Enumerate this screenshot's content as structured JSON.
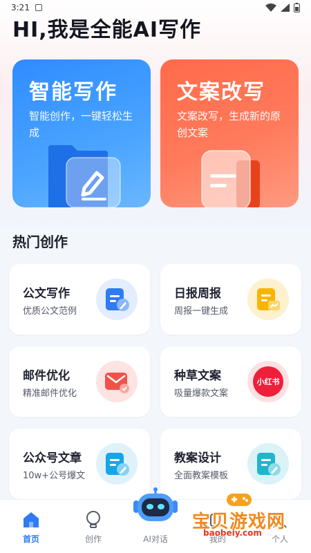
{
  "status": {
    "time": "3:21"
  },
  "header": {
    "title": "HI,我是全能AI写作"
  },
  "features": [
    {
      "title": "智能写作",
      "desc": "智能创作，一键轻松生成",
      "color": "#3a96ff"
    },
    {
      "title": "文案改写",
      "desc": "文案改写，生成新的原创文案",
      "color": "#ff6f50"
    }
  ],
  "section": {
    "title": "热门创作"
  },
  "tiles": [
    {
      "title": "公文写作",
      "sub": "优质公文范例",
      "icon": "document-pen-icon"
    },
    {
      "title": "日报周报",
      "sub": "周报一键生成",
      "icon": "report-chart-icon"
    },
    {
      "title": "邮件优化",
      "sub": "精准邮件优化",
      "icon": "mail-icon"
    },
    {
      "title": "种草文案",
      "sub": "吸量爆款文案",
      "icon": "xiaohongshu-logo",
      "logo_text": "小红书"
    },
    {
      "title": "公众号文章",
      "sub": "10w+公号爆文",
      "icon": "article-pen-icon"
    },
    {
      "title": "教案设计",
      "sub": "全面教案模板",
      "icon": "lesson-plan-icon"
    }
  ],
  "nav": [
    {
      "label": "首页",
      "icon": "home-icon",
      "active": true
    },
    {
      "label": "创作",
      "icon": "lightbulb-icon"
    },
    {
      "label": "AI对话",
      "icon": "robot-icon"
    },
    {
      "label": "我的",
      "icon": "folder-icon"
    },
    {
      "label": "个人",
      "icon": "person-icon"
    }
  ],
  "watermark": {
    "text": "宝贝游戏网",
    "url": "baobeiy.com"
  },
  "colors": {
    "accent": "#2f7bf5",
    "blue_card": "#3a96ff",
    "red_card": "#ff6f50"
  }
}
